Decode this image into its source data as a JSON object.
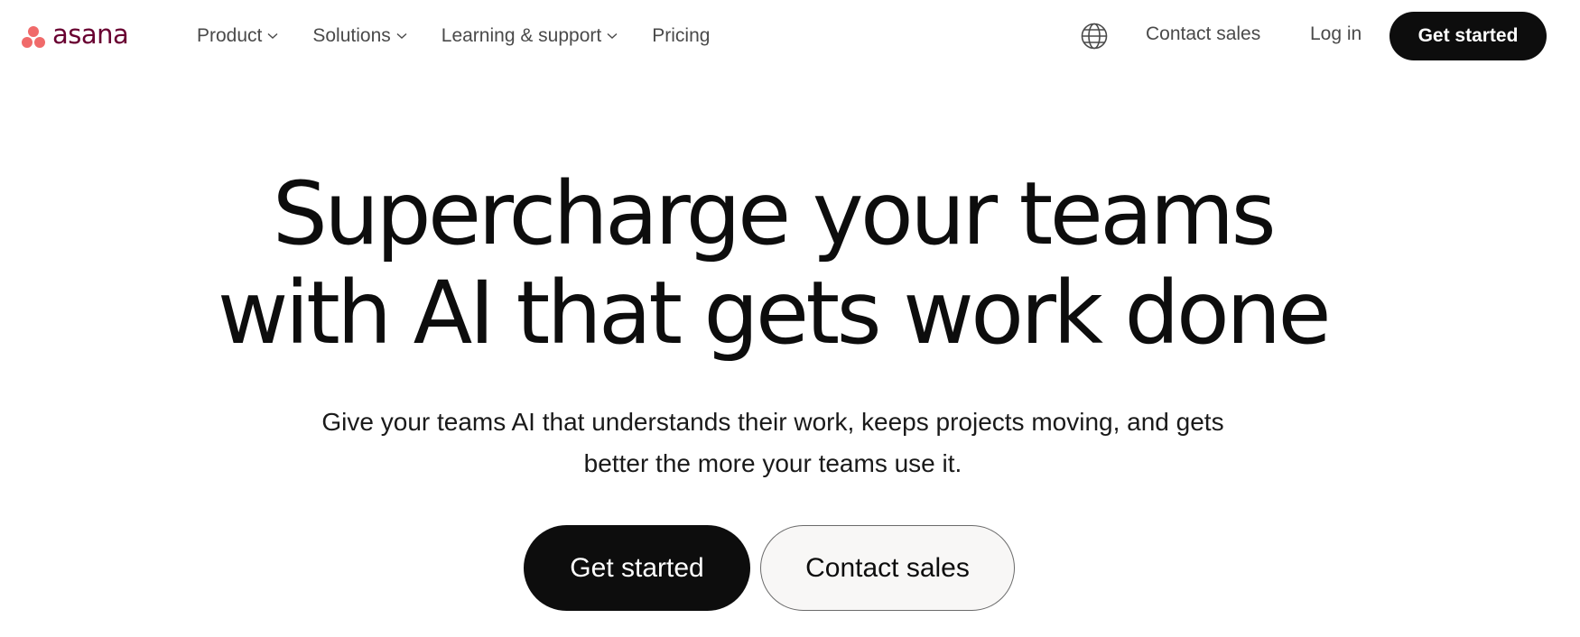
{
  "brand": {
    "name": "asana",
    "logo_icon": "asana-three-dots-icon",
    "dot_color": "#f06a6a",
    "wordmark_color": "#690031"
  },
  "nav": {
    "items": [
      {
        "label": "Product",
        "has_dropdown": true
      },
      {
        "label": "Solutions",
        "has_dropdown": true
      },
      {
        "label": "Learning & support",
        "has_dropdown": true
      },
      {
        "label": "Pricing",
        "has_dropdown": false
      }
    ],
    "language_icon": "globe-icon",
    "contact_sales": "Contact sales",
    "log_in": "Log in",
    "get_started": "Get started"
  },
  "hero": {
    "title_lines": [
      "Supercharge your teams",
      "with AI that gets work done"
    ],
    "subtitle_lines": [
      "Give your teams AI that understands their work, keeps projects moving, and gets",
      "better the more your teams use it."
    ],
    "primary_cta": "Get started",
    "secondary_cta": "Contact sales"
  },
  "colors": {
    "primary_button": "#0d0d0d",
    "secondary_button_bg": "#f8f7f6",
    "text": "#121212",
    "nav_text": "#4a4a4a"
  }
}
